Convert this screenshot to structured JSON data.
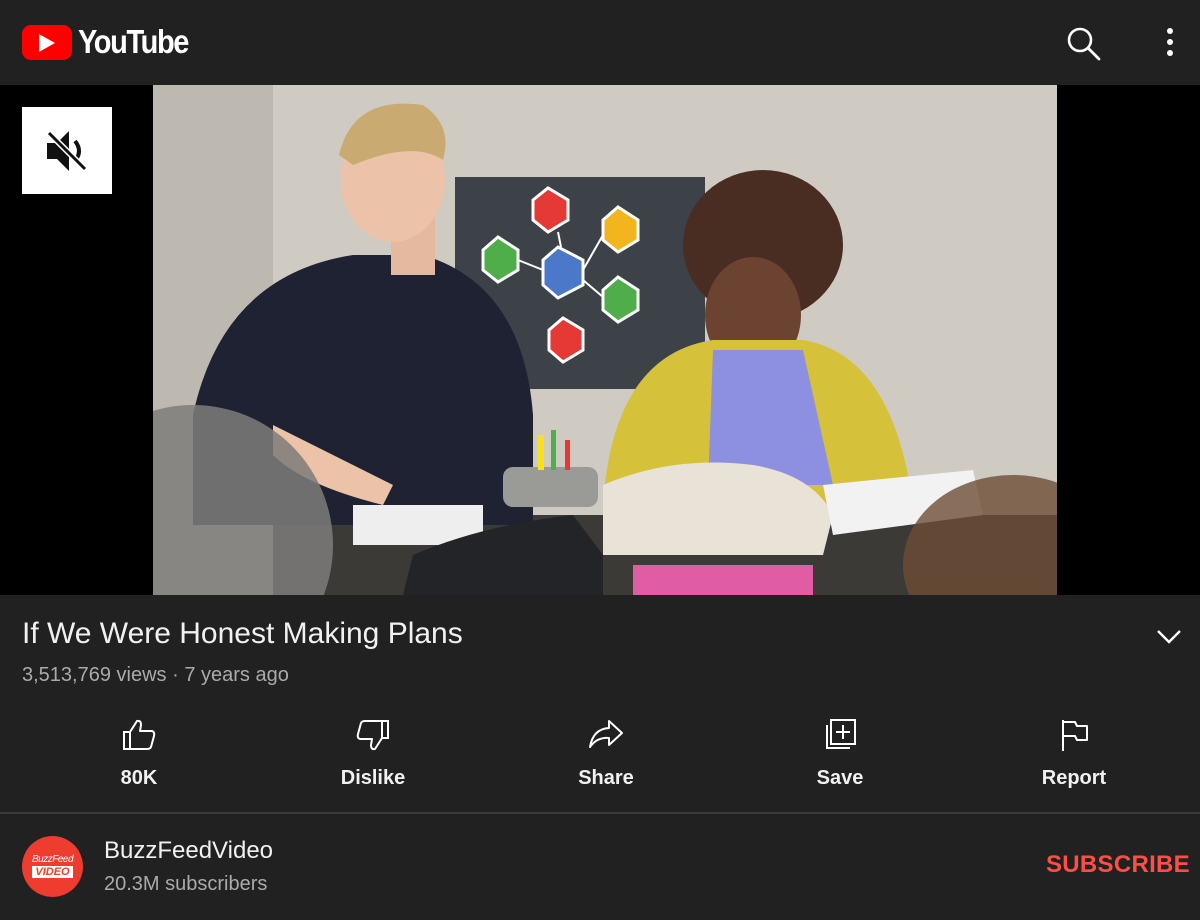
{
  "header": {
    "logo_text": "YouTube",
    "search_icon": "search-icon",
    "more_icon": "more-vertical-icon"
  },
  "player": {
    "mute_icon": "volume-muted-icon"
  },
  "video": {
    "title": "If We Were Honest Making Plans",
    "views": "3,513,769 views",
    "separator": "·",
    "age": "7 years ago"
  },
  "actions": [
    {
      "label": "80K",
      "icon": "thumbs-up-icon"
    },
    {
      "label": "Dislike",
      "icon": "thumbs-down-icon"
    },
    {
      "label": "Share",
      "icon": "share-arrow-icon"
    },
    {
      "label": "Save",
      "icon": "add-to-playlist-icon"
    },
    {
      "label": "Report",
      "icon": "flag-icon"
    }
  ],
  "channel": {
    "name": "BuzzFeedVideo",
    "subscribers": "20.3M subscribers",
    "avatar_line1": "BuzzFeed",
    "avatar_line2": "VIDEO",
    "subscribe_label": "SUBSCRIBE"
  },
  "colors": {
    "background": "#212121",
    "brand_red": "#ff0000",
    "subscribe_red": "#ff4e45",
    "secondary_text": "#aaaaaa"
  }
}
